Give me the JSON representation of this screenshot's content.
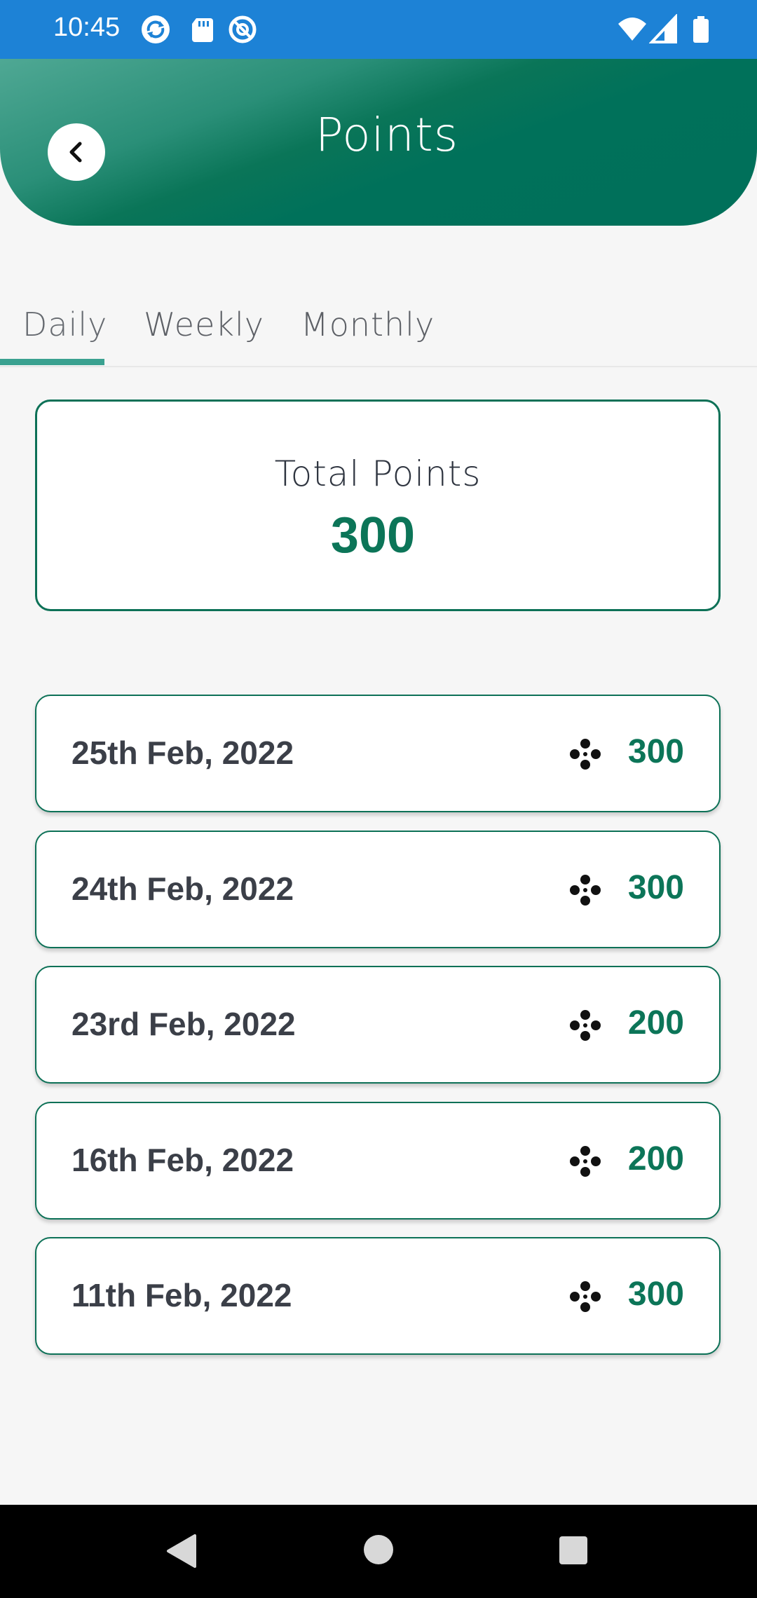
{
  "status_bar": {
    "time": "10:45",
    "icons": [
      "sync-icon",
      "sd-card-icon",
      "data-saver-icon",
      "wifi-icon",
      "cell-signal-icon",
      "battery-icon"
    ]
  },
  "header": {
    "title": "Points",
    "back_icon": "chevron-left-icon"
  },
  "tabs": [
    {
      "label": "Daily",
      "selected": true
    },
    {
      "label": "Weekly",
      "selected": false
    },
    {
      "label": "Monthly",
      "selected": false
    }
  ],
  "total": {
    "label": "Total Points",
    "value": "300"
  },
  "entries": [
    {
      "date": "25th Feb, 2022",
      "points": "300"
    },
    {
      "date": "24th Feb, 2022",
      "points": "300"
    },
    {
      "date": "23rd Feb, 2022",
      "points": "200"
    },
    {
      "date": "16th Feb, 2022",
      "points": "200"
    },
    {
      "date": "11th Feb, 2022",
      "points": "300"
    }
  ],
  "colors": {
    "status_bar": "#1d82d6",
    "header_dark": "#00705a",
    "header_light": "#4fa894",
    "accent": "#0c7558",
    "tab_indicator": "#3aa190",
    "background": "#f6f6f6"
  },
  "nav_bar": {
    "buttons": [
      "back-triangle-icon",
      "home-circle-icon",
      "recents-square-icon"
    ]
  }
}
